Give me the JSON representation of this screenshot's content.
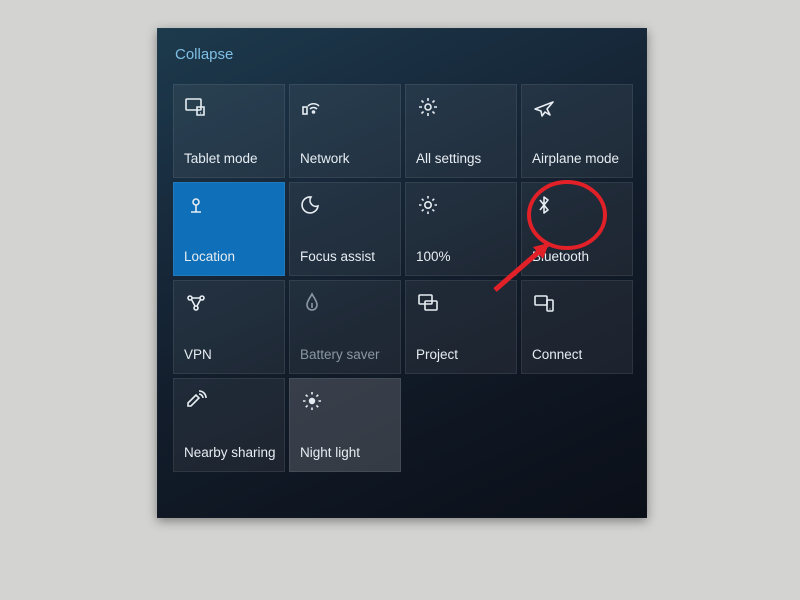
{
  "collapse_label": "Collapse",
  "tiles": {
    "tablet_mode": "Tablet mode",
    "network": "Network",
    "all_settings": "All settings",
    "airplane_mode": "Airplane mode",
    "location": "Location",
    "focus_assist": "Focus assist",
    "brightness": "100%",
    "bluetooth": "Bluetooth",
    "vpn": "VPN",
    "battery_saver": "Battery saver",
    "project": "Project",
    "connect": "Connect",
    "nearby_sharing": "Nearby sharing",
    "night_light": "Night light"
  },
  "tile_states": {
    "location": "active",
    "night_light": "night",
    "battery_saver": "disabled"
  },
  "annotation": {
    "target_tile": "bluetooth",
    "circle_color": "#e22028",
    "arrow_color": "#e22028"
  }
}
